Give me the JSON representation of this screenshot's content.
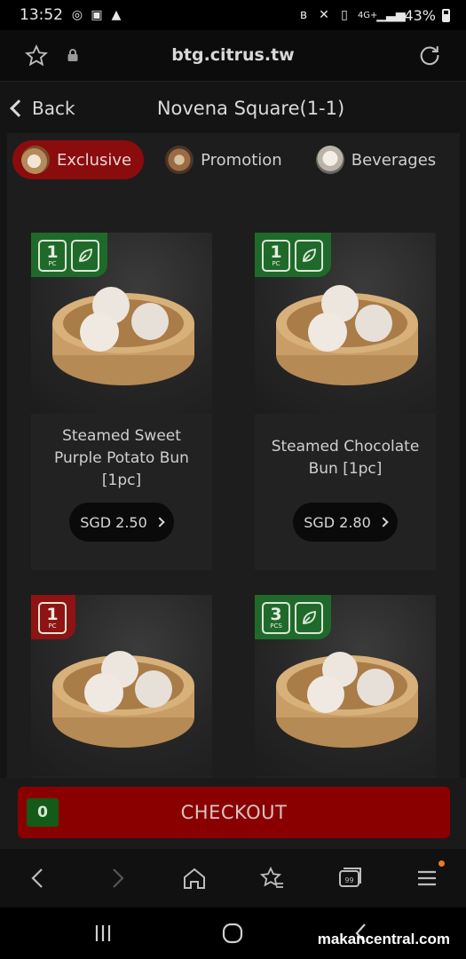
{
  "status_bar": {
    "time": "13:52",
    "network": "4G+",
    "battery_percent": "43%",
    "battery_level": 0.43
  },
  "browser": {
    "url": "btg.citrus.tw"
  },
  "header": {
    "back_label": "Back",
    "title": "Novena Square(1-1)"
  },
  "categories": [
    {
      "label": "Exclusive",
      "icon": "exclusive-thumbnail",
      "active": true
    },
    {
      "label": "Promotion",
      "icon": "promotion-thumbnail",
      "active": false
    },
    {
      "label": "Beverages",
      "icon": "beverages-thumbnail",
      "active": false
    }
  ],
  "products": [
    {
      "name": "Steamed Sweet Purple Potato Bun [1pc]",
      "price": "SGD 2.50",
      "badge_qty": "1",
      "badge_unit": "PC",
      "badge_color": "#1f6a2a",
      "vegetarian": true
    },
    {
      "name": "Steamed Chocolate Bun [1pc]",
      "price": "SGD 2.80",
      "badge_qty": "1",
      "badge_unit": "PC",
      "badge_color": "#1f6a2a",
      "vegetarian": true
    },
    {
      "name": "",
      "price": "",
      "badge_qty": "1",
      "badge_unit": "PC",
      "badge_color": "#8f1313",
      "vegetarian": false
    },
    {
      "name": "",
      "price": "",
      "badge_qty": "3",
      "badge_unit": "PCS",
      "badge_color": "#1f6a2a",
      "vegetarian": true
    }
  ],
  "checkout": {
    "count": "0",
    "label": "CHECKOUT"
  },
  "watermark": "makancentral.com",
  "colors": {
    "accent_red": "#8a0c0c",
    "checkout_red": "#8a0000",
    "badge_green": "#1f6a2a",
    "notification": "#f07a22"
  }
}
